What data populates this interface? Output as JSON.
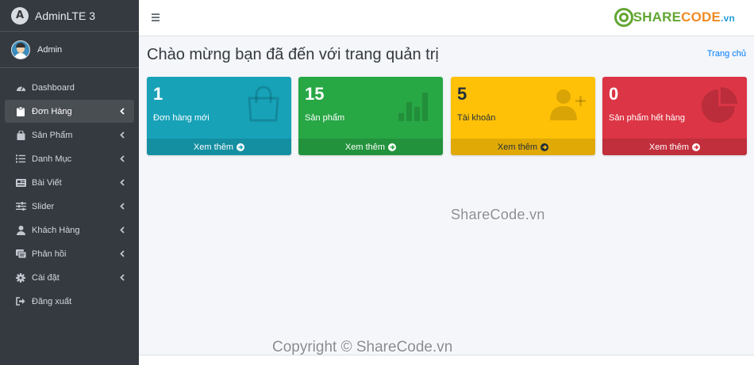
{
  "brand": {
    "name": "AdminLTE 3",
    "logo_letter": "A"
  },
  "user": {
    "name": "Admin"
  },
  "sidebar": {
    "items": [
      {
        "label": "Dashboard",
        "icon": "dashboard-icon",
        "has_arrow": false,
        "active": false
      },
      {
        "label": "Đơn Hàng",
        "icon": "clipboard-icon",
        "has_arrow": true,
        "active": true
      },
      {
        "label": "Sản Phẩm",
        "icon": "shopping-bag-icon",
        "has_arrow": true,
        "active": false
      },
      {
        "label": "Danh Mục",
        "icon": "list-icon",
        "has_arrow": true,
        "active": false
      },
      {
        "label": "Bài Viết",
        "icon": "newspaper-icon",
        "has_arrow": true,
        "active": false
      },
      {
        "label": "Slider",
        "icon": "sliders-icon",
        "has_arrow": true,
        "active": false
      },
      {
        "label": "Khách Hàng",
        "icon": "user-icon",
        "has_arrow": true,
        "active": false
      },
      {
        "label": "Phản hồi",
        "icon": "feedback-icon",
        "has_arrow": true,
        "active": false
      },
      {
        "label": "Cài đặt",
        "icon": "gear-icon",
        "has_arrow": true,
        "active": false
      },
      {
        "label": "Đăng xuất",
        "icon": "sign-out-icon",
        "has_arrow": false,
        "active": false
      }
    ]
  },
  "header": {
    "menu_icon": "hamburger-icon",
    "logo": {
      "part1": "SHARE",
      "part2": "CODE",
      "part3": ".vn"
    }
  },
  "main": {
    "title": "Chào mừng bạn đã đến với trang quản trị",
    "breadcrumb": "Trang chủ",
    "boxes": [
      {
        "value": "1",
        "label": "Đơn hàng mới",
        "link": "Xem thêm",
        "color": "#17a2b8",
        "icon": "shopping-bag-icon"
      },
      {
        "value": "15",
        "label": "Sản phẩm",
        "link": "Xem thêm",
        "color": "#28a745",
        "icon": "bar-chart-icon"
      },
      {
        "value": "5",
        "label": "Tài khoản",
        "link": "Xem thêm",
        "color": "#ffc107",
        "icon": "user-plus-icon"
      },
      {
        "value": "0",
        "label": "Sản phẩm hết hàng",
        "link": "Xem thêm",
        "color": "#dc3545",
        "icon": "pie-chart-icon"
      }
    ]
  },
  "watermark": "ShareCode.vn",
  "copyright": "Copyright © ShareCode.vn"
}
